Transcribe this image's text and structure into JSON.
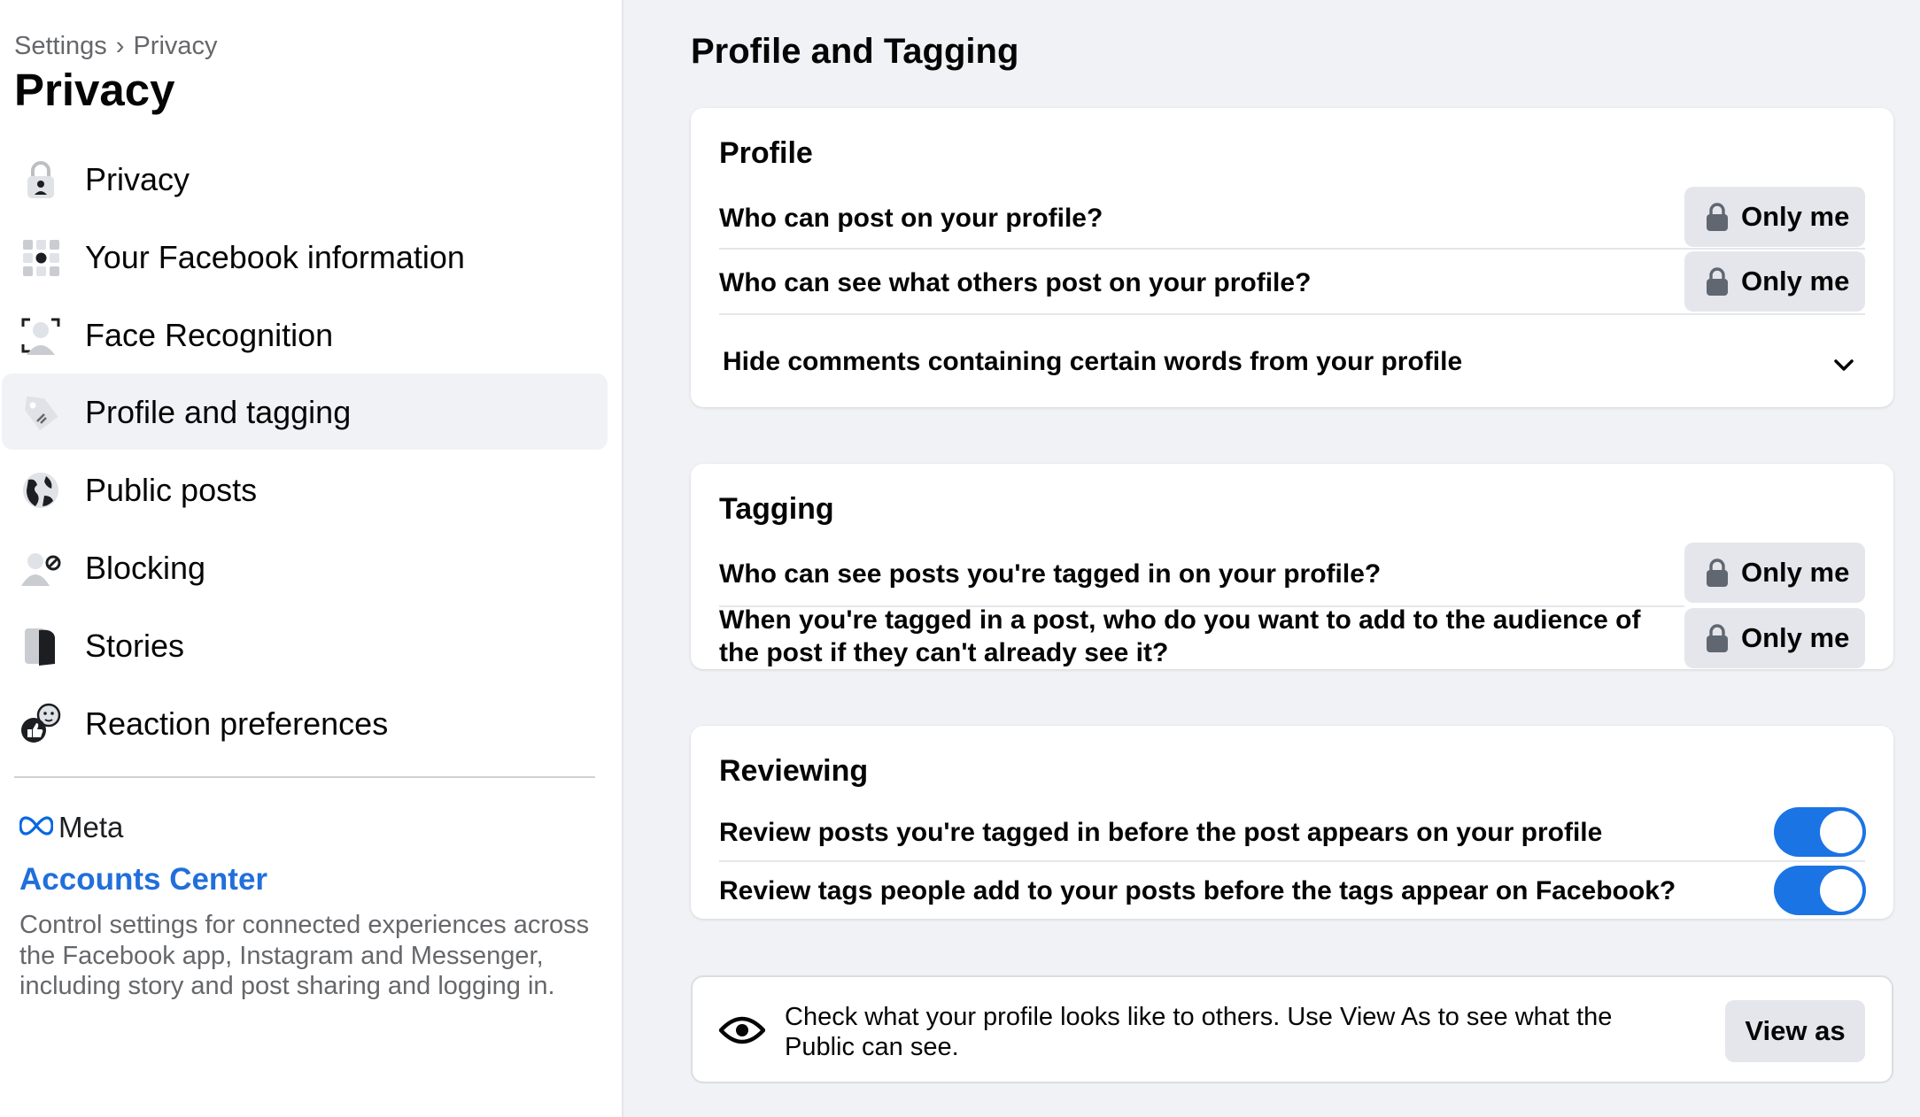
{
  "sidebar": {
    "breadcrumb": {
      "first": "Settings",
      "separator": "›",
      "second": "Privacy"
    },
    "title": "Privacy",
    "items": [
      {
        "label": "Privacy",
        "icon": "lock-icon",
        "active": false
      },
      {
        "label": "Your Facebook information",
        "icon": "info-grid-icon",
        "active": false
      },
      {
        "label": "Face Recognition",
        "icon": "face-scan-icon",
        "active": false
      },
      {
        "label": "Profile and tagging",
        "icon": "tag-icon",
        "active": true
      },
      {
        "label": "Public posts",
        "icon": "globe-icon",
        "active": false
      },
      {
        "label": "Blocking",
        "icon": "block-user-icon",
        "active": false
      },
      {
        "label": "Stories",
        "icon": "stories-icon",
        "active": false
      },
      {
        "label": "Reaction preferences",
        "icon": "reactions-icon",
        "active": false
      }
    ],
    "meta": {
      "logo_text": "Meta",
      "accounts_center": "Accounts Center",
      "description": "Control settings for connected experiences across the Facebook app, Instagram and Messenger, including story and post sharing and logging in."
    }
  },
  "main": {
    "title": "Profile and Tagging",
    "profile": {
      "title": "Profile",
      "rows": [
        {
          "question": "Who can post on your profile?",
          "value": "Only me"
        },
        {
          "question": "Who can see what others post on your profile?",
          "value": "Only me"
        }
      ],
      "hide_comments": "Hide comments containing certain words from your profile"
    },
    "tagging": {
      "title": "Tagging",
      "rows": [
        {
          "question": "Who can see posts you're tagged in on your profile?",
          "value": "Only me"
        },
        {
          "question": "When you're tagged in a post, who do you want to add to the audience of the post if they can't already see it?",
          "value": "Only me"
        }
      ]
    },
    "reviewing": {
      "title": "Reviewing",
      "rows": [
        {
          "label": "Review posts you're tagged in before the post appears on your profile",
          "enabled": true
        },
        {
          "label": "Review tags people add to your posts before the tags appear on Facebook?",
          "enabled": true
        }
      ]
    },
    "view_as": {
      "description": "Check what your profile looks like to others. Use View As to see what the Public can see.",
      "button": "View as"
    }
  },
  "colors": {
    "accent": "#1b74e4",
    "link": "#216fdb",
    "background": "#f0f2f5",
    "button_gray": "#e4e6eb"
  }
}
